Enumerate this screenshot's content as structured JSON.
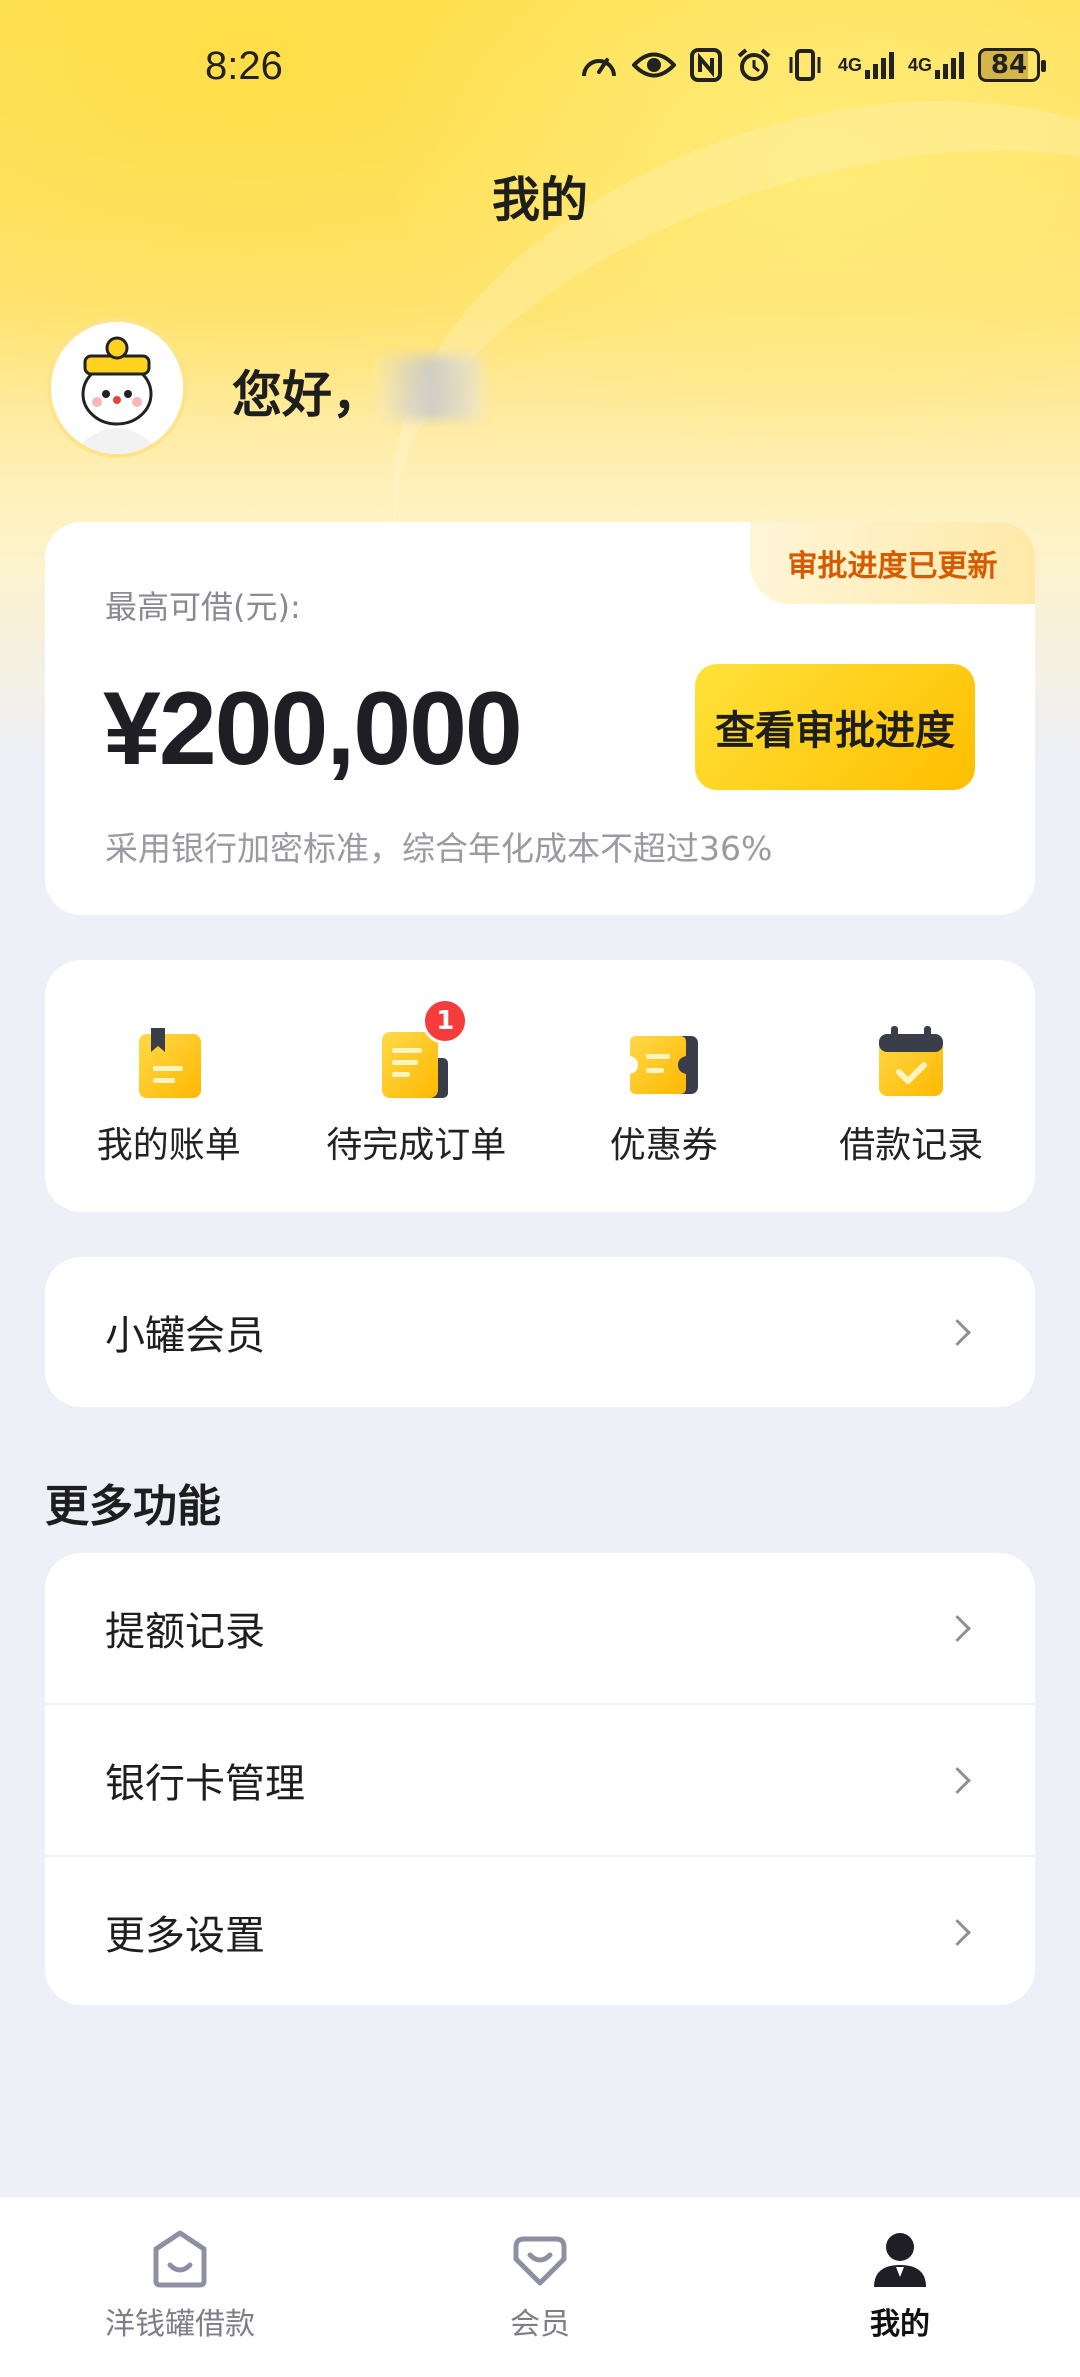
{
  "status_bar": {
    "time": "8:26",
    "network_1": "4G",
    "network_2": "4G",
    "battery": "84"
  },
  "header": {
    "title": "我的"
  },
  "profile": {
    "greeting": "您好，"
  },
  "credit": {
    "badge": "审批进度已更新",
    "label": "最高可借(元):",
    "amount": "¥200,000",
    "button": "查看审批进度",
    "note": "采用银行加密标准，综合年化成本不超过36%"
  },
  "shortcuts": [
    {
      "label": "我的账单",
      "icon": "bill-icon"
    },
    {
      "label": "待完成订单",
      "icon": "order-icon",
      "badge": "1"
    },
    {
      "label": "优惠券",
      "icon": "coupon-icon"
    },
    {
      "label": "借款记录",
      "icon": "calendar-icon"
    }
  ],
  "member": {
    "label": "小罐会员"
  },
  "more": {
    "title": "更多功能",
    "items": [
      {
        "label": "提额记录"
      },
      {
        "label": "银行卡管理"
      },
      {
        "label": "更多设置"
      }
    ]
  },
  "tabbar": {
    "active": 2,
    "items": [
      {
        "label": "洋钱罐借款",
        "icon": "jar-icon"
      },
      {
        "label": "会员",
        "icon": "member-icon"
      },
      {
        "label": "我的",
        "icon": "profile-icon"
      }
    ]
  },
  "colors": {
    "accent": "#FFC800",
    "badge_text": "#D65A00",
    "notification": "#F53C3C"
  }
}
